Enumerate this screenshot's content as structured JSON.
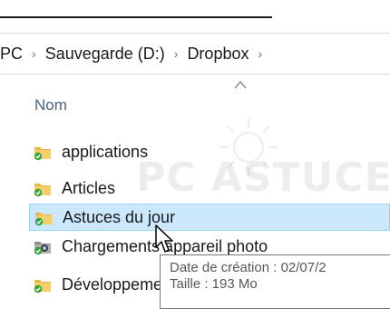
{
  "address": {
    "crumbs": [
      "PC",
      "Sauvegarde (D:)",
      "Dropbox"
    ],
    "separator": "›"
  },
  "columns": {
    "name_label": "Nom"
  },
  "files": [
    {
      "name": "applications",
      "icon": "folder-sync-icon",
      "selected": false
    },
    {
      "name": "Articles",
      "icon": "folder-sync-icon",
      "selected": false
    },
    {
      "name": "Astuces du jour",
      "icon": "folder-sync-icon",
      "selected": true
    },
    {
      "name": "Chargements appareil photo",
      "icon": "camera-folder-sync-icon",
      "selected": false
    },
    {
      "name": "Développement",
      "icon": "folder-sync-icon",
      "selected": false
    }
  ],
  "watermark": {
    "text": "PC ASTUCES"
  },
  "tooltip": {
    "line1": "Date de création : 02/07/2",
    "line2": "Taille : 193 Mo"
  },
  "colors": {
    "selection_bg": "#cce8ff",
    "selection_border": "#99d1ff",
    "folder_yellow": "#e8b84a",
    "sync_green": "#3aa341",
    "header_text": "#4a6380"
  }
}
